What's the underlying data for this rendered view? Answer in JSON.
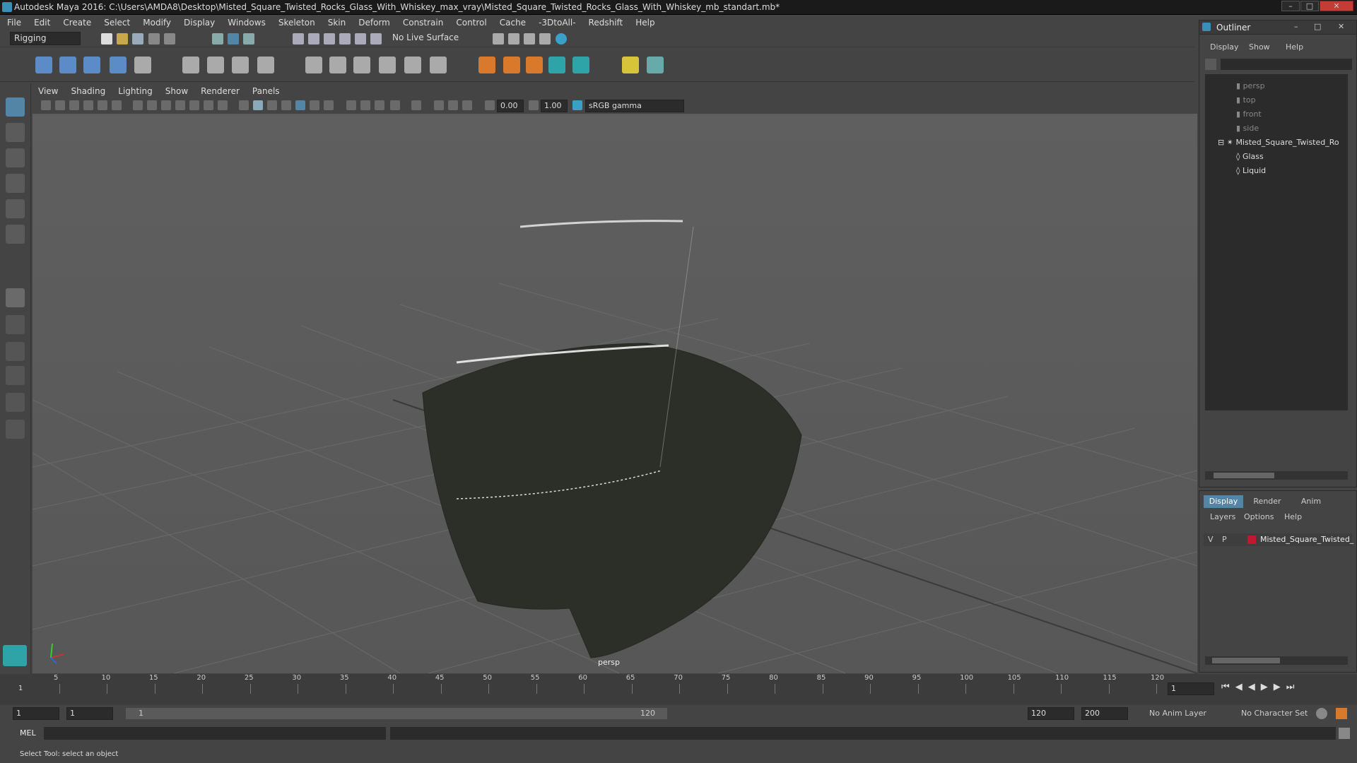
{
  "window": {
    "title": "Autodesk Maya 2016: C:\\Users\\AMDA8\\Desktop\\Misted_Square_Twisted_Rocks_Glass_With_Whiskey_max_vray\\Misted_Square_Twisted_Rocks_Glass_With_Whiskey_mb_standart.mb*",
    "controls": [
      "–",
      "□",
      "✕"
    ]
  },
  "menubar": [
    "File",
    "Edit",
    "Create",
    "Select",
    "Modify",
    "Display",
    "Windows",
    "Skeleton",
    "Skin",
    "Deform",
    "Constrain",
    "Control",
    "Cache",
    "-3DtoAll-",
    "Redshift",
    "Help"
  ],
  "statusline": {
    "menu_set": "Rigging",
    "live_surface": "No Live Surface"
  },
  "viewport": {
    "menus": [
      "View",
      "Shading",
      "Lighting",
      "Show",
      "Renderer",
      "Panels"
    ],
    "exposure": "0.00",
    "gamma": "1.00",
    "color_space": "sRGB gamma",
    "camera_label": "persp"
  },
  "outliner": {
    "title": "Outliner",
    "menus": [
      "Display",
      "Show",
      "Help"
    ],
    "items": [
      {
        "label": "persp",
        "type": "camera"
      },
      {
        "label": "top",
        "type": "camera"
      },
      {
        "label": "front",
        "type": "camera"
      },
      {
        "label": "side",
        "type": "camera"
      },
      {
        "label": "Misted_Square_Twisted_Ro",
        "type": "group"
      },
      {
        "label": "Glass",
        "type": "mesh"
      },
      {
        "label": "Liquid",
        "type": "mesh"
      }
    ]
  },
  "channel_box": {
    "tabs": [
      "Display",
      "Render",
      "Anim"
    ],
    "menus": [
      "Layers",
      "Options",
      "Help"
    ],
    "layer": {
      "v": "V",
      "p": "P",
      "name": "Misted_Square_Twisted_",
      "color": "#c0182f"
    }
  },
  "timeline": {
    "ticks": [
      "5",
      "10",
      "15",
      "20",
      "25",
      "30",
      "35",
      "40",
      "45",
      "50",
      "55",
      "60",
      "65",
      "70",
      "75",
      "80",
      "85",
      "90",
      "95",
      "100",
      "105",
      "110",
      "115",
      "120"
    ],
    "start_label": "1",
    "current_frame": "1"
  },
  "range": {
    "start": "1",
    "playback_start": "1",
    "slider_start": "1",
    "slider_end": "120",
    "playback_end": "120",
    "end": "200",
    "anim_layer": "No Anim Layer",
    "character_set": "No Character Set"
  },
  "command": {
    "label": "MEL"
  },
  "status": {
    "help_text": "Select Tool: select an object"
  },
  "colors": {
    "accent": "#5285a6",
    "layer_color": "#c0182f",
    "viewport_bg": "#5a5a5a"
  }
}
